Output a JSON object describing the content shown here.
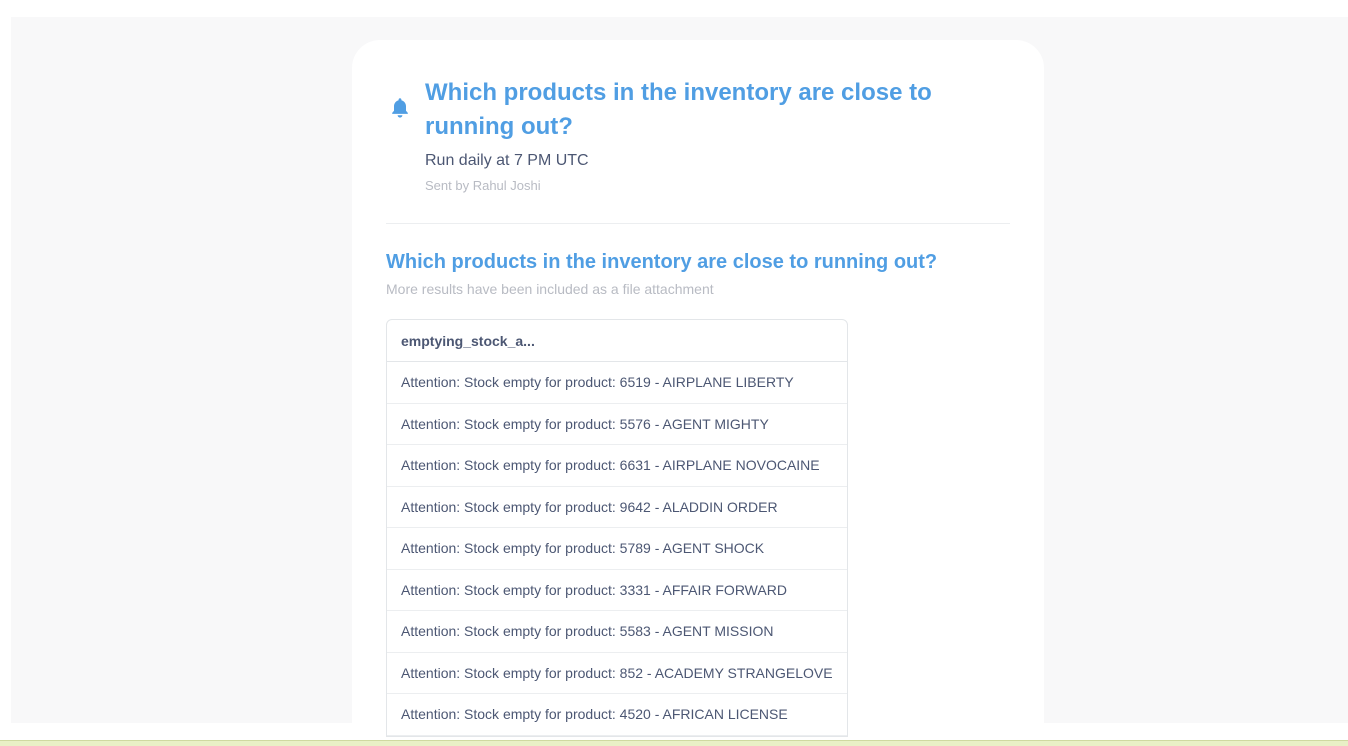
{
  "alert": {
    "title": "Which products in the inventory are close to running out?",
    "schedule": "Run daily at 7 PM UTC",
    "sender": "Sent by Rahul Joshi",
    "icon": "bell-icon"
  },
  "question": {
    "title": "Which products in the inventory are close to running out?",
    "note": "More results have been included as a file attachment"
  },
  "table": {
    "column_header": "emptying_stock_a...",
    "rows": [
      "Attention: Stock empty for product: 6519 - AIRPLANE LIBERTY",
      "Attention: Stock empty for product: 5576 - AGENT MIGHTY",
      "Attention: Stock empty for product: 6631 - AIRPLANE NOVOCAINE",
      "Attention: Stock empty for product: 9642 - ALADDIN ORDER",
      "Attention: Stock empty for product: 5789 - AGENT SHOCK",
      "Attention: Stock empty for product: 3331 - AFFAIR FORWARD",
      "Attention: Stock empty for product: 5583 - AGENT MISSION",
      "Attention: Stock empty for product: 852 - ACADEMY STRANGELOVE",
      "Attention: Stock empty for product: 4520 - AFRICAN LICENSE"
    ]
  },
  "colors": {
    "accent": "#509ee3",
    "text": "#4c5773",
    "muted": "#b8bbc3",
    "background": "#f8f8f9"
  }
}
